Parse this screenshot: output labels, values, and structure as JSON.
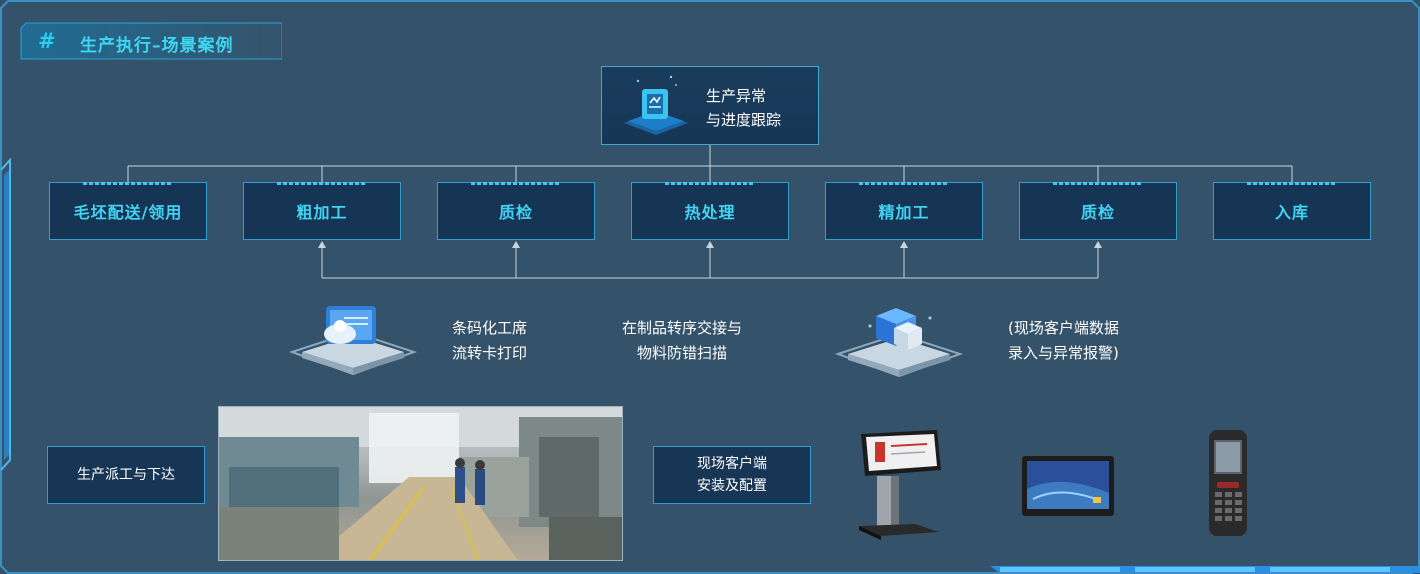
{
  "header": {
    "title": "生产执行–场景案例",
    "icon": "grid-hash-icon"
  },
  "top_card": {
    "line1": "生产异常",
    "line2": "与进度跟踪",
    "icon": "document-chart-icon"
  },
  "steps": [
    {
      "label": "毛坯配送/领用"
    },
    {
      "label": "粗加工"
    },
    {
      "label": "质检"
    },
    {
      "label": "热处理"
    },
    {
      "label": "精加工"
    },
    {
      "label": "质检"
    },
    {
      "label": "入库"
    }
  ],
  "features": {
    "barcode": {
      "line1": "条码化工席",
      "line2": "流转卡打印",
      "icon": "barcode-print-icon"
    },
    "scan": {
      "line1": "在制品转序交接与",
      "line2": "物料防错扫描"
    },
    "client": {
      "line1": "(现场客户端数据",
      "line2": "录入与异常报警)",
      "icon": "cube-data-icon"
    }
  },
  "bottom": {
    "dispatch": {
      "label": "生产派工与下达"
    },
    "install": {
      "line1": "现场客户端",
      "line2": "安装及配置"
    },
    "photo": {
      "alt": "workshop-photo"
    },
    "devices": [
      "kiosk-terminal",
      "tablet-screen",
      "handheld-scanner"
    ]
  },
  "colors": {
    "background": "#34536b",
    "accent": "#42d3f3",
    "border": "#2f9fd0",
    "card": "#163554"
  }
}
